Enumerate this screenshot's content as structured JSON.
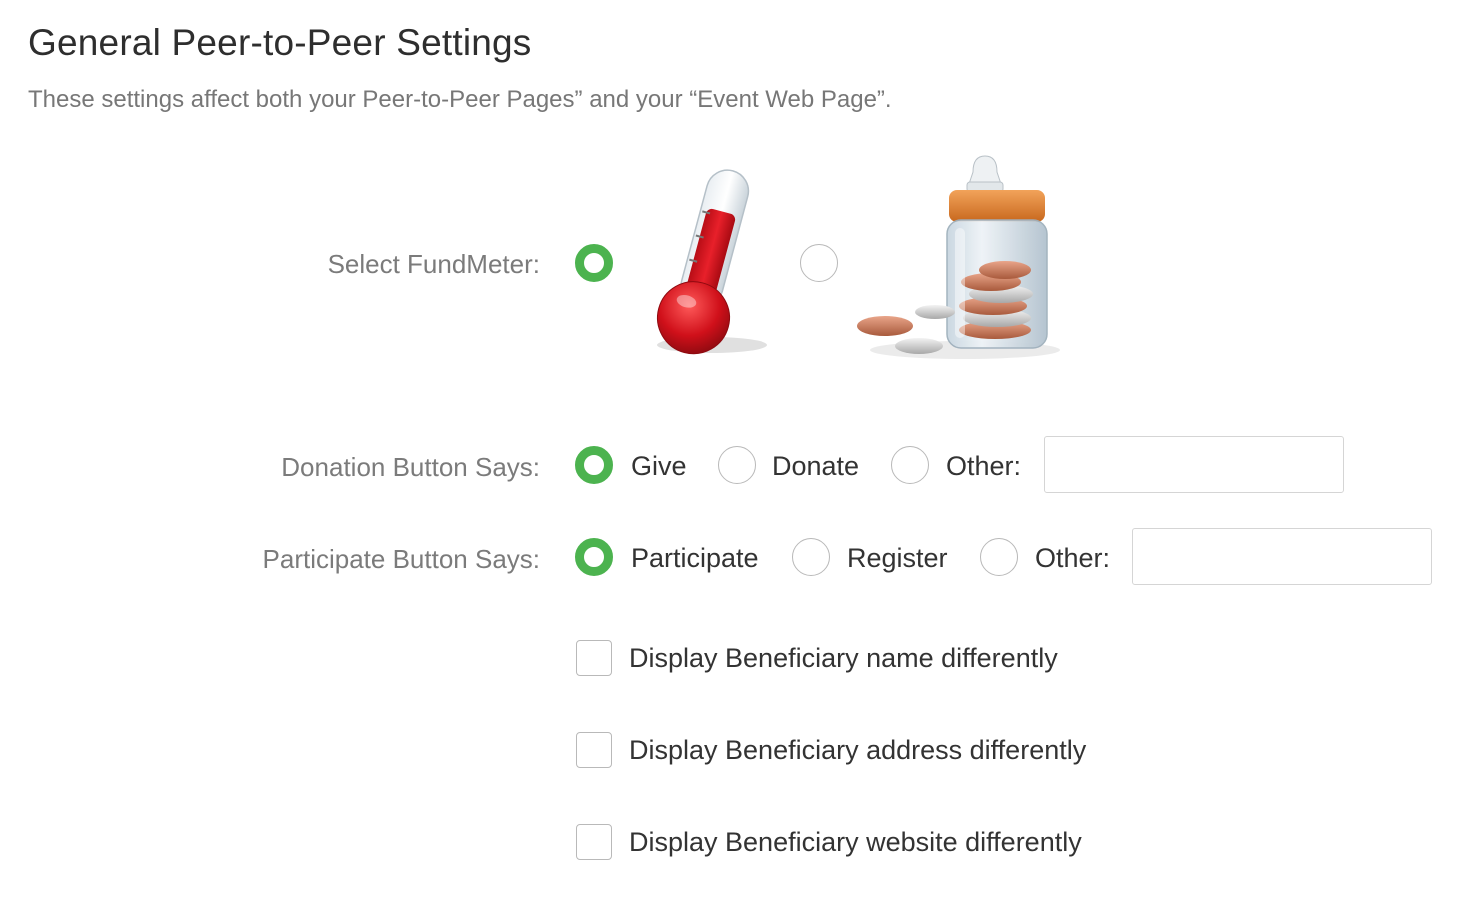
{
  "header": {
    "title": "General Peer-to-Peer Settings",
    "subtitle": "These settings affect both your Peer-to-Peer Pages” and your “Event Web Page”."
  },
  "fundmeter": {
    "label": "Select FundMeter:",
    "options": [
      {
        "name": "thermometer",
        "selected": true
      },
      {
        "name": "coin-jar",
        "selected": false
      }
    ]
  },
  "donation": {
    "label": "Donation Button Says:",
    "options": [
      "Give",
      "Donate",
      "Other:"
    ],
    "selected": "Give",
    "other_value": ""
  },
  "participate": {
    "label": "Participate Button Says:",
    "options": [
      "Participate",
      "Register",
      "Other:"
    ],
    "selected": "Participate",
    "other_value": ""
  },
  "checkboxes": [
    {
      "label": "Display Beneficiary name differently",
      "checked": false
    },
    {
      "label": "Display Beneficiary address differently",
      "checked": false
    },
    {
      "label": "Display Beneficiary website differently",
      "checked": false
    }
  ],
  "colors": {
    "accent": "#4cb34f",
    "label_gray": "#7b7b7b",
    "border_gray": "#b9b9b9"
  }
}
